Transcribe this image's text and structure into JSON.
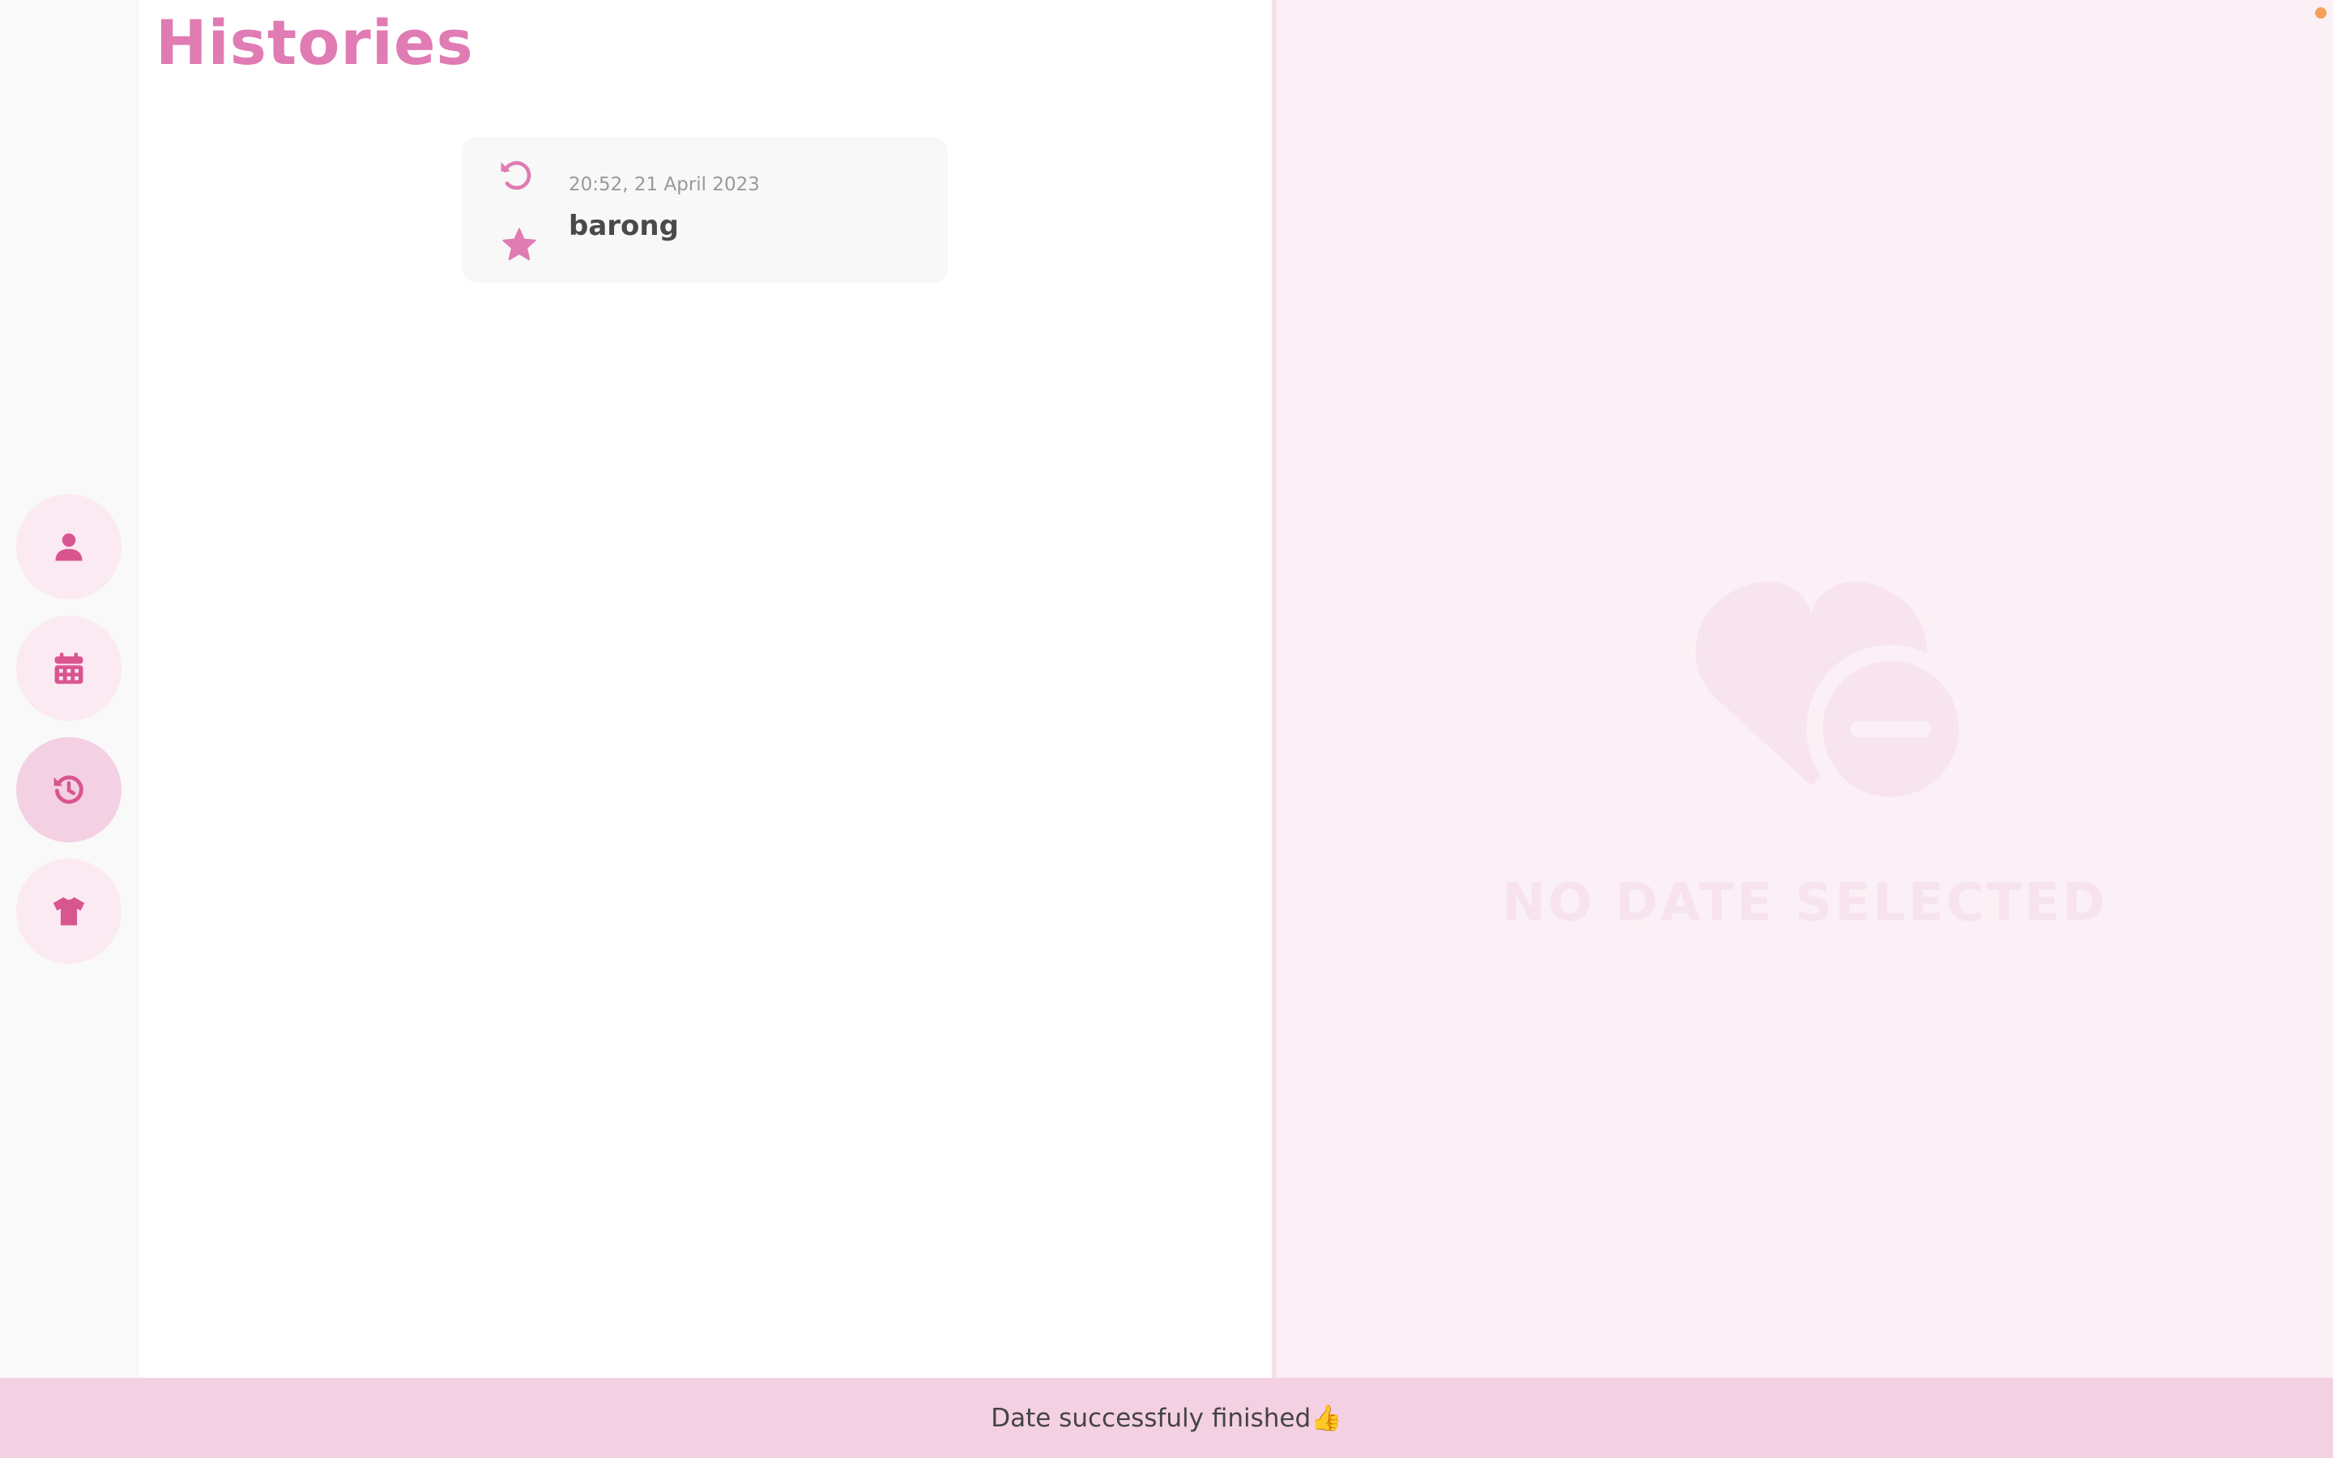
{
  "page": {
    "title": "Histories"
  },
  "sidebar": {
    "items": [
      {
        "icon": "user-icon",
        "active": false
      },
      {
        "icon": "calendar-icon",
        "active": false
      },
      {
        "icon": "history-icon",
        "active": true
      },
      {
        "icon": "shirt-icon",
        "active": false
      }
    ]
  },
  "histories": [
    {
      "timestamp": "20:52, 21 April 2023",
      "name": "barong",
      "restore_icon": "restore-icon",
      "favorite_icon": "star-icon"
    }
  ],
  "detail": {
    "empty_text": "NO DATE SELECTED",
    "empty_icon": "heart-minus-icon"
  },
  "toast": {
    "message": "Date successfuly finished👍"
  },
  "colors": {
    "accent": "#e07bb3",
    "icon": "#d9558f",
    "nav_bg": "#fbeaf2",
    "nav_active_bg": "#f4d0e3",
    "panel_bg": "#fbf0f5",
    "toast_bg": "#f4d0e3",
    "status_dot": "#f5a05a"
  }
}
